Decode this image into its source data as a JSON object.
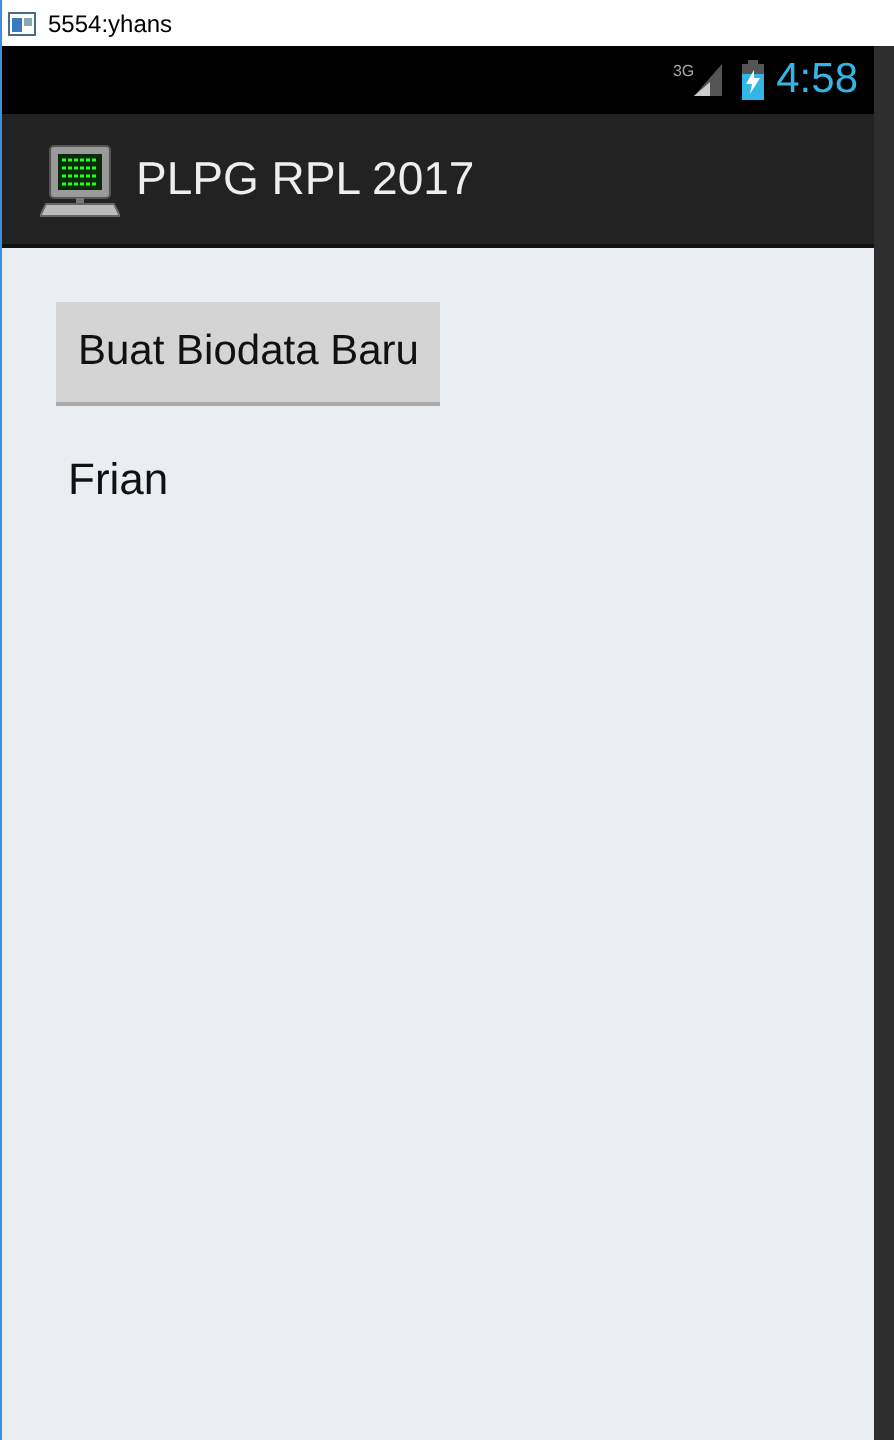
{
  "window": {
    "title": "5554:yhans"
  },
  "status_bar": {
    "network": "3G",
    "time": "4:58"
  },
  "action_bar": {
    "title": "PLPG RPL 2017"
  },
  "content": {
    "button": "Buat Biodata Baru",
    "items": [
      "Frian"
    ]
  }
}
